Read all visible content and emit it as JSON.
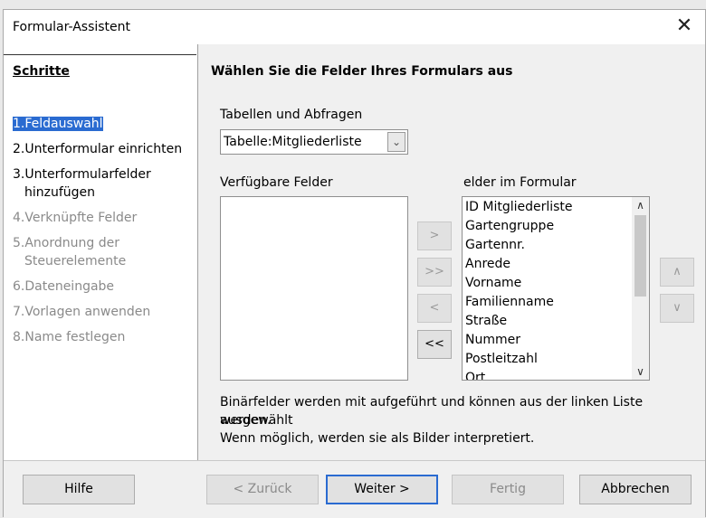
{
  "window": {
    "title": "Formular-Assistent",
    "close_glyph": "✕"
  },
  "steps": {
    "title": "Schritte",
    "items": [
      {
        "label": "1.Feldauswahl"
      },
      {
        "label": "2.Unterformular einrichten"
      },
      {
        "label": "3.Unterformularfelder"
      },
      {
        "label": "hinzufügen"
      },
      {
        "label": "4.Verknüpfte Felder"
      },
      {
        "label": "5.Anordnung der"
      },
      {
        "label": "Steuerelemente"
      },
      {
        "label": "6.Dateneingabe"
      },
      {
        "label": "7.Vorlagen anwenden"
      },
      {
        "label": "8.Name festlegen"
      }
    ]
  },
  "main": {
    "heading": "Wählen Sie die Felder Ihres Formulars aus",
    "tables_label": "Tabellen und Abfragen",
    "tables_value": "Tabelle:Mitgliederliste",
    "available_label": "Verfügbare Felder",
    "form_fields_label": "elder im Formular",
    "form_fields": [
      "ID Mitgliederliste",
      "Gartengruppe",
      "Gartennr.",
      "Anrede",
      "Vorname",
      "Familienname",
      "Straße",
      "Nummer",
      "Postleitzahl",
      "Ort"
    ],
    "move_buttons": {
      "add_one": ">",
      "add_all": ">>",
      "remove_one": "<",
      "remove_all": "<<"
    },
    "order_buttons": {
      "up": "∧",
      "down": "∨"
    },
    "scroll_up": "∧",
    "scroll_down": "∨",
    "note_line1": "Binärfelder werden mit aufgeführt und können aus der linken Liste ausgewählt",
    "note_line2": "werden.",
    "note_line3": "Wenn möglich, werden sie als Bilder interpretiert."
  },
  "footer": {
    "help": "Hilfe",
    "back": "< Zurück",
    "next": "Weiter >",
    "finish": "Fertig",
    "cancel": "Abbrechen"
  },
  "colors": {
    "accent": "#2a6bd1",
    "disabled_text": "#8a8a8a"
  }
}
